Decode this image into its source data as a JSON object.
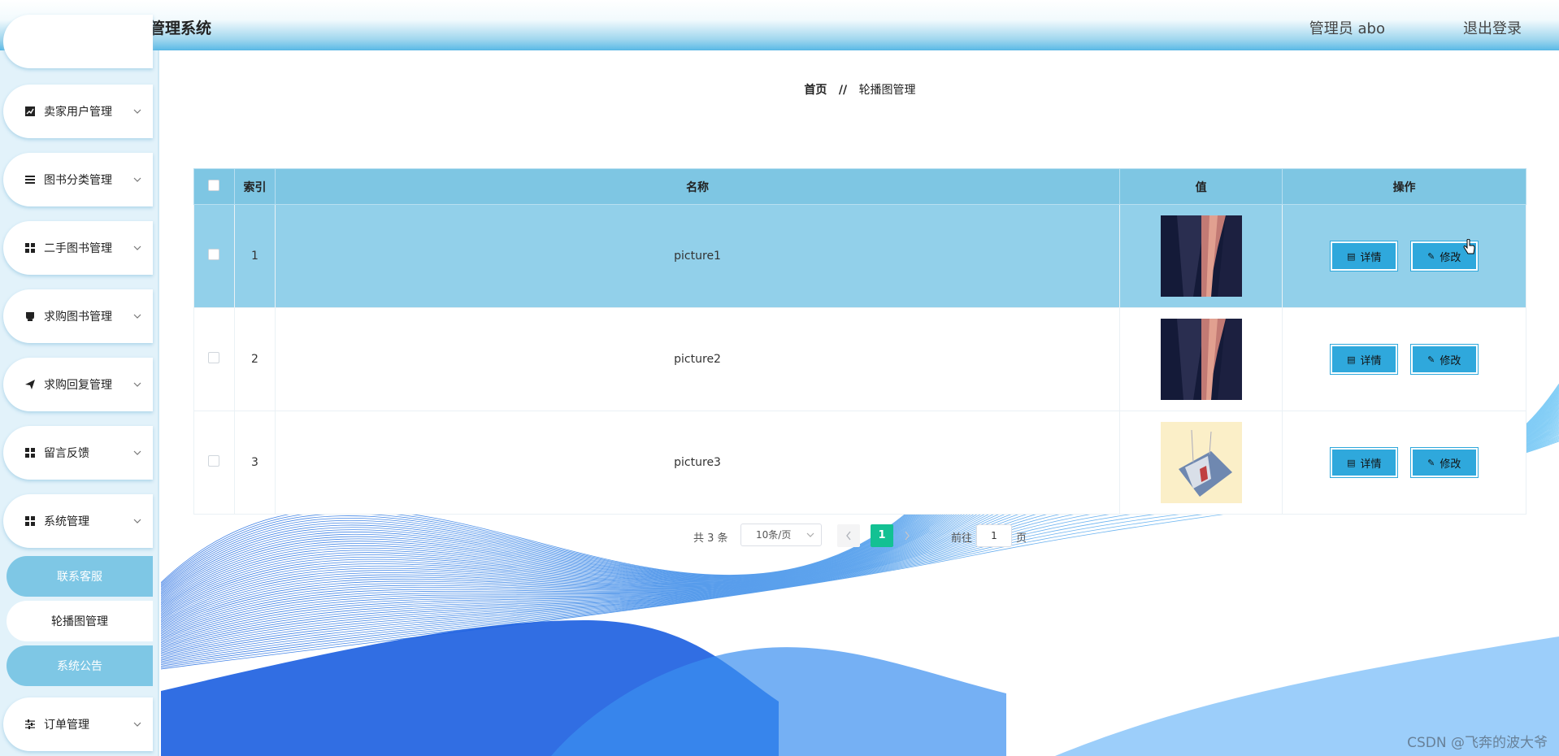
{
  "header": {
    "title": "乐校园二手书交易管理系统",
    "user": "管理员 abo",
    "logout": "退出登录"
  },
  "sidebar": {
    "menus": [
      {
        "label": "卖家用户管理",
        "icon": "chart-icon"
      },
      {
        "label": "图书分类管理",
        "icon": "list-icon"
      },
      {
        "label": "二手图书管理",
        "icon": "grid-icon"
      },
      {
        "label": "求购图书管理",
        "icon": "cup-icon"
      },
      {
        "label": "求购回复管理",
        "icon": "send-icon"
      },
      {
        "label": "留言反馈",
        "icon": "grid-icon"
      },
      {
        "label": "系统管理",
        "icon": "grid-icon"
      }
    ],
    "sub_items": [
      {
        "label": "联系客服"
      },
      {
        "label": "轮播图管理"
      },
      {
        "label": "系统公告"
      }
    ],
    "order_menu": {
      "label": "订单管理",
      "icon": "sliders-icon"
    }
  },
  "breadcrumb": {
    "home": "首页",
    "separator": "//",
    "current": "轮播图管理"
  },
  "table": {
    "headers": {
      "index": "索引",
      "name": "名称",
      "value": "值",
      "action": "操作"
    },
    "rows": [
      {
        "index": "1",
        "name": "picture1"
      },
      {
        "index": "2",
        "name": "picture2"
      },
      {
        "index": "3",
        "name": "picture3"
      }
    ],
    "detail_label": "详情",
    "edit_label": "修改"
  },
  "pagination": {
    "total": "共 3 条",
    "page_size": "10条/页",
    "current_page": "1",
    "goto_prefix": "前往",
    "goto_value": "1",
    "goto_suffix": "页"
  },
  "watermark": "CSDN @飞奔的波大爷",
  "colors": {
    "header_gradient_end": "#5fbbe6",
    "table_header": "#7ec6e3",
    "selected_row": "#92d0ea",
    "button": "#2fa8dc",
    "active_page": "#13c193"
  }
}
